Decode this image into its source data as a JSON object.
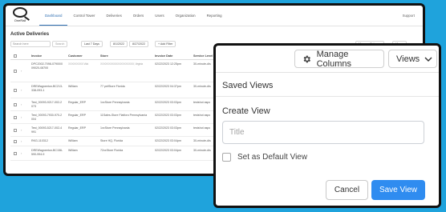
{
  "app": {
    "logo_text": "OneRail",
    "nav": [
      "Dashboard",
      "Control Tower",
      "Deliveries",
      "Orders",
      "Users",
      "Organization",
      "Reporting"
    ],
    "active_nav": "Dashboard",
    "support": "Support"
  },
  "page": {
    "title": "Active Deliveries",
    "search_placeholder": "Search here",
    "search_btn": "Search",
    "range_select": "Last 7 Days",
    "date_from": "8/1/2022",
    "date_to": "8/27/2022",
    "add_filter": "+ Add Filter",
    "manage_columns_small": "Manage Columns",
    "views_small": "Views"
  },
  "table": {
    "headers": [
      "Invoice",
      "Customer",
      "Store",
      "Invoice Date",
      "Service Level"
    ],
    "rows": [
      {
        "invoice": "DPC2002-7098-07900/009020-08700",
        "customer": "XXXXXXXXX Wal",
        "store": "XXXXXXXXXXXXXXXXXXXX, Virginia",
        "date": "02/22/2023 12:25pm",
        "service": "30-minute-dis"
      },
      {
        "invoice": "DREWagneeton-BC213-338-093-1",
        "customer": "William",
        "store": "77 petStore Florida",
        "date": "02/22/2023 04:37pm",
        "service": "30-minute-dis"
      },
      {
        "invoice": "Test_00093-9217-002-2073",
        "customer": "Regular_ERP",
        "store": "1xxStore Pennsylvania",
        "date": "02/22/2023 03:03pm",
        "service": "testshot aspc"
      },
      {
        "invoice": "Test_00093-7930-970-2004",
        "customer": "Regular_ERP",
        "store": "11Sales-Store Flatforo Pennsylvania",
        "date": "02/22/2023 03:03pm",
        "service": "testshot aspc"
      },
      {
        "invoice": "Test_00093-5217-002-4991",
        "customer": "Regular_ERP",
        "store": "1xxStore Pennsylvania",
        "date": "02/22/2023 03:03pm",
        "service": "testshot aspc"
      },
      {
        "invoice": "RKG-110312",
        "customer": "William",
        "store": "Store HQ, Florida",
        "date": "02/22/2023 03:04pm",
        "service": "30-minute-dis"
      },
      {
        "invoice": "DREWagneeton-BC156-590-994-9",
        "customer": "William",
        "store": "72xxStore Florida",
        "date": "02/22/2023 03:04pm",
        "service": "30-minute-dis"
      }
    ]
  },
  "dialog": {
    "manage_columns": "Manage Columns",
    "views": "Views",
    "saved_views_title": "Saved Views",
    "create_view_title": "Create View",
    "title_placeholder": "Title",
    "title_value": "",
    "default_label": "Set as Default View",
    "default_checked": false,
    "cancel": "Cancel",
    "save": "Save View"
  },
  "colors": {
    "background": "#1fa3dc",
    "primary_button": "#2f8cf0",
    "active_nav": "#2b6cb0"
  }
}
